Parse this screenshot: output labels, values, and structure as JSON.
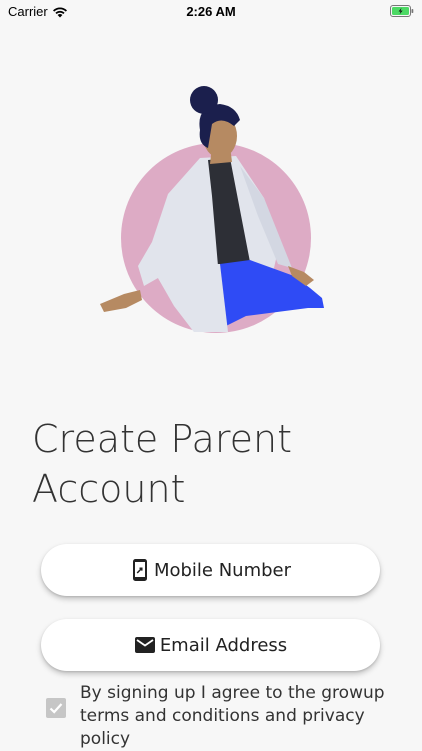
{
  "status_bar": {
    "carrier": "Carrier",
    "time": "2:26 AM",
    "battery_color": "#4cd964"
  },
  "hero": {
    "circle_color": "#ddabc5",
    "coat_color": "#e1e4ec",
    "pants_color": "#2f4bf5",
    "hair_color": "#1b1f4d",
    "skin_color": "#b68a62"
  },
  "title": {
    "line1": "Create Parent",
    "line2": "Account"
  },
  "buttons": {
    "mobile": {
      "label": "Mobile Number",
      "icon": "mobile-phone-icon"
    },
    "email": {
      "label": "Email Address",
      "icon": "envelope-icon"
    }
  },
  "consent": {
    "checked": true,
    "text": "By signing up I agree to the growup terms and conditions and privacy policy"
  }
}
